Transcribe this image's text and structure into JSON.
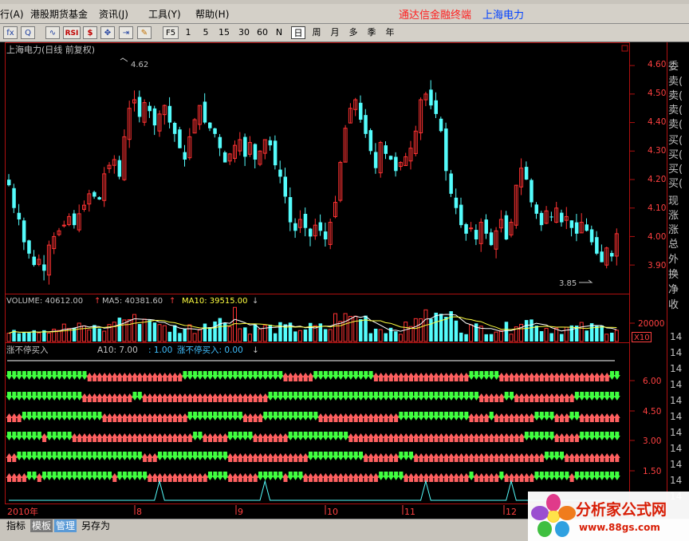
{
  "menubar": {
    "items": [
      {
        "label": "行(A)"
      },
      {
        "label": "港股期货基金"
      },
      {
        "label": "资讯(J)"
      },
      {
        "label": "工具(Y)"
      },
      {
        "label": "帮助(H)"
      }
    ],
    "brand": "通达信金融终端",
    "stock": "上海电力"
  },
  "toolbar": {
    "icons": [
      {
        "label": "fx",
        "name": "formula-icon"
      },
      {
        "label": "Q",
        "name": "zoom-icon"
      },
      {
        "label": "∿",
        "name": "chart-icon"
      },
      {
        "label": "RSI",
        "name": "rsi-icon"
      },
      {
        "label": "$",
        "name": "dollar-icon"
      },
      {
        "label": "✥",
        "name": "move-icon"
      },
      {
        "label": "⇥",
        "name": "jump-icon"
      },
      {
        "label": "✎",
        "name": "pencil-icon"
      }
    ],
    "f5": "F5",
    "periods": [
      "1",
      "5",
      "15",
      "30",
      "60",
      "N",
      "日",
      "周",
      "月",
      "多",
      "季",
      "年"
    ],
    "selected_period": "日"
  },
  "chart": {
    "title": "上海电力(日线 前复权)",
    "high_label": "4.62",
    "low_label": "3.85",
    "price_ticks": [
      "4.60",
      "4.50",
      "4.40",
      "4.30",
      "4.20",
      "4.10",
      "4.00",
      "3.90"
    ],
    "volume": {
      "label": "VOLUME: 40612.00",
      "ma5": "MA5: 40381.60",
      "ma10": "MA10: 39515.00",
      "tick": "20000",
      "unit": "X10"
    },
    "indicator": {
      "name": "涨不停买入",
      "a10": "A10: 7.00",
      "val": ": 1.00",
      "buy": "涨不停买入: 0.00",
      "ticks": [
        "6.00",
        "4.50",
        "3.00",
        "1.50"
      ]
    },
    "dates": [
      "2010年",
      "8",
      "9",
      "10",
      "11",
      "12"
    ],
    "right_labels": [
      "委",
      "卖(",
      "卖(",
      "卖(",
      "卖(",
      "买(",
      "买(",
      "买(",
      "买(",
      "现",
      "涨",
      "涨",
      "总",
      "外",
      "换",
      "净",
      "收"
    ],
    "right_time": "14"
  },
  "chart_data": {
    "type": "candlestick",
    "title": "上海电力(日线 前复权)",
    "ylim": [
      3.85,
      4.62
    ],
    "closes": [
      4.18,
      4.1,
      4.06,
      3.98,
      3.94,
      3.9,
      3.92,
      3.88,
      3.97,
      4.0,
      4.02,
      4.04,
      4.07,
      4.04,
      4.08,
      4.11,
      4.15,
      4.14,
      4.13,
      4.22,
      4.25,
      4.27,
      4.21,
      4.35,
      4.45,
      4.48,
      4.42,
      4.47,
      4.44,
      4.39,
      4.43,
      4.46,
      4.4,
      4.36,
      4.31,
      4.27,
      4.35,
      4.41,
      4.46,
      4.4,
      4.38,
      4.36,
      4.31,
      4.26,
      4.29,
      4.32,
      4.34,
      4.28,
      4.33,
      4.27,
      4.3,
      4.34,
      4.32,
      4.25,
      4.21,
      4.14,
      4.05,
      4.02,
      4.06,
      4.03,
      4.0,
      4.04,
      4.02,
      3.99,
      4.05,
      4.12,
      4.26,
      4.38,
      4.45,
      4.48,
      4.41,
      4.36,
      4.3,
      4.24,
      4.33,
      4.29,
      4.27,
      4.23,
      4.26,
      4.28,
      4.31,
      4.37,
      4.48,
      4.5,
      4.46,
      4.43,
      4.37,
      4.23,
      4.15,
      4.1,
      4.04,
      4.01,
      4.03,
      3.99,
      4.05,
      4.01,
      3.97,
      4.02,
      4.06,
      3.99,
      4.05,
      4.18,
      4.24,
      4.2,
      4.12,
      4.08,
      4.04,
      4.09,
      4.07,
      4.1,
      4.05,
      4.07,
      4.03,
      4.01,
      4.05,
      4.02,
      3.98,
      3.94,
      3.91,
      3.96,
      3.93,
      4.01
    ],
    "buy_pattern": [
      0,
      0,
      0,
      0,
      0,
      0,
      0,
      0,
      0,
      0,
      0,
      0,
      0,
      0,
      0,
      0,
      0,
      0,
      0,
      0,
      0,
      0,
      0,
      0,
      0,
      0,
      0,
      0,
      0,
      0,
      1,
      0,
      0,
      0,
      0,
      0,
      0,
      0,
      0,
      0,
      0,
      0,
      0,
      0,
      0,
      0,
      0,
      0,
      0,
      0,
      0,
      1,
      0,
      0,
      0,
      0,
      0,
      0,
      0,
      0,
      0,
      0,
      0,
      0,
      0,
      0,
      0,
      0,
      0,
      0,
      0,
      0,
      0,
      0,
      0,
      0,
      0,
      0,
      0,
      0,
      0,
      0,
      0,
      1,
      0,
      0,
      0,
      0,
      0,
      0,
      0,
      0,
      0,
      0,
      0,
      0,
      0,
      0,
      0,
      0,
      1,
      0,
      0,
      0,
      0,
      0,
      0,
      0,
      0,
      0,
      0,
      0,
      0,
      0,
      0,
      0,
      0,
      0,
      0,
      0,
      0,
      0
    ]
  }
}
